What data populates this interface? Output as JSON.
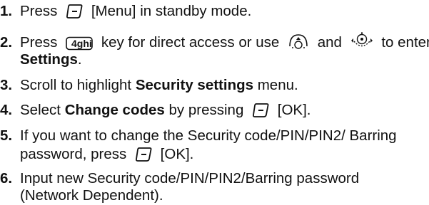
{
  "steps": [
    {
      "num": "1.",
      "before": "Press",
      "key_label": "[Menu]",
      "after": "in standby mode."
    },
    {
      "num": "2.",
      "before": "Press",
      "mid1": "key for direct access or use",
      "mid2": "and",
      "after": "to enter",
      "line2_bold": "Settings",
      "line2_end": "."
    },
    {
      "num": "3.",
      "before": "Scroll to highlight",
      "bold": "Security settings",
      "after": "menu."
    },
    {
      "num": "4.",
      "before": "Select",
      "bold": "Change codes",
      "mid": "by pressing",
      "after": "[OK]."
    },
    {
      "num": "5.",
      "line1": "If you want to change the Security code/PIN/PIN2/ Barring",
      "line2_before": "password, press",
      "line2_after": "[OK]."
    },
    {
      "num": "6.",
      "line1": "Input new Security code/PIN/PIN2/Barring password",
      "line2": "(Network Dependent)."
    }
  ],
  "icons": {
    "soft_key": "left-soft-key-icon",
    "key4": "key-4-ghi-icon",
    "nav_up": "nav-up-icon",
    "nav_center": "nav-center-icon",
    "key4_text": "4ghi"
  }
}
